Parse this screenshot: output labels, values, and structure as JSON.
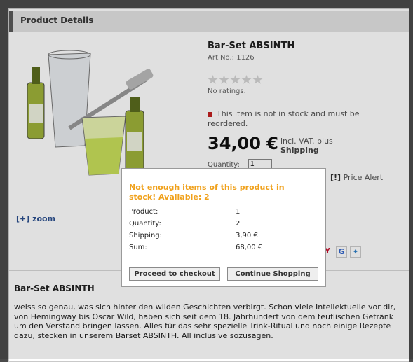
{
  "panel": {
    "title": "Product Details"
  },
  "product": {
    "name": "Bar-Set ABSINTH",
    "art_no": "Art.No.: 1126",
    "ratings_text": "No ratings.",
    "stock_text": "This item is not in stock and must be reordered.",
    "price": "34,00 €",
    "vat_text": "incl. VAT. plus",
    "shipping_link": "Shipping",
    "quantity_label": "Quantity:",
    "quantity_value": "1",
    "price_alert_icon": "[!]",
    "price_alert": "Price Alert",
    "zoom_link": "[+] zoom",
    "stars": 0,
    "stock_color": "#c21f1f"
  },
  "description": {
    "title": "Bar-Set ABSINTH",
    "text": "weiss so genau, was sich hinter den wilden Geschichten verbirgt. Schon viele Intellektuelle vor dir, von Hemingway bis Oscar Wild, haben sich seit dem 18. Jahrhundert von dem teuflischen Getränk um den Verstand bringen lassen. Alles für das sehr spezielle Trink-Ritual und noch einige Rezepte dazu, stecken in unserem Barset ABSINTH. All inclusive sozusagen."
  },
  "social": [
    "yahoo-icon",
    "google-icon",
    "bookmark-icon"
  ],
  "modal": {
    "warning": "Not enough items of this product in stock! Available: 2",
    "warning_color": "#f0a11c",
    "rows": [
      {
        "label": "Product:",
        "value": "1"
      },
      {
        "label": "Quantity:",
        "value": "2"
      },
      {
        "label": "Shipping:",
        "value": "3,90 €"
      },
      {
        "label": "Sum:",
        "value": "68,00 €"
      }
    ],
    "checkout_button": "Proceed to checkout",
    "continue_button": "Continue Shopping"
  }
}
